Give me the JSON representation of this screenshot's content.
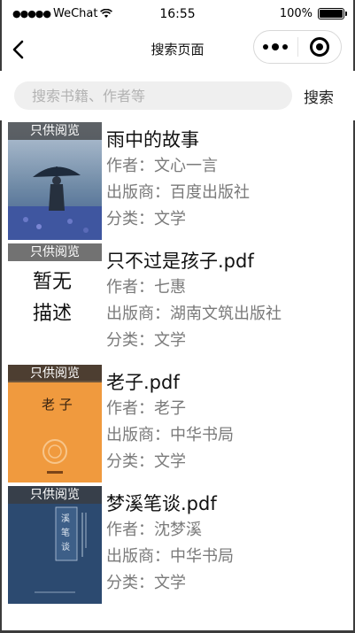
{
  "status_bar": {
    "carrier": "WeChat",
    "time": "16:55",
    "battery": "100%",
    "battery_level": 1.0
  },
  "nav": {
    "title": "搜索页面"
  },
  "search": {
    "placeholder": "搜索书籍、作者等",
    "value": "",
    "button_label": "搜索"
  },
  "badge_label": "只供阅览",
  "books": [
    {
      "title": "雨中的故事",
      "author_label": "作者：",
      "author": "文心一言",
      "publisher_label": "出版商：",
      "publisher": "百度出版社",
      "category_label": "分类：",
      "category": "文学"
    },
    {
      "title": "只不过是孩子.pdf",
      "author_label": "作者：",
      "author": "七惠",
      "publisher_label": "出版商：",
      "publisher": "湖南文筑出版社",
      "category_label": "分类：",
      "category": "文学"
    },
    {
      "title": "老子.pdf",
      "author_label": "作者：",
      "author": "老子",
      "publisher_label": "出版商：",
      "publisher": "中华书局",
      "category_label": "分类：",
      "category": "文学"
    },
    {
      "title": "梦溪笔谈.pdf",
      "author_label": "作者：",
      "author": "沈梦溪",
      "publisher_label": "出版商：",
      "publisher": "中华书局",
      "category_label": "分类：",
      "category": "文学"
    }
  ],
  "covers": [
    {
      "text": ""
    },
    {
      "text": "暂无描述"
    },
    {
      "text": "老子"
    },
    {
      "text": "梦溪笔谈"
    }
  ]
}
